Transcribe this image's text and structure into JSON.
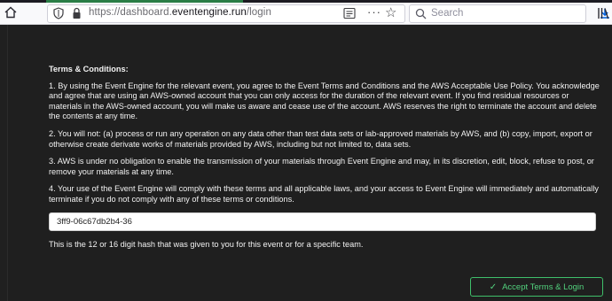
{
  "browser": {
    "url_prefix": "https://dashboard.",
    "url_domain": "eventengine.run",
    "url_path": "/login",
    "search_placeholder": "Search",
    "more_label": "···",
    "star_label": "☆"
  },
  "terms": {
    "title": "Terms & Conditions:",
    "paragraphs": [
      "1. By using the Event Engine for the relevant event, you agree to the Event Terms and Conditions and the AWS Acceptable Use Policy. You acknowledge and agree that are using an AWS-owned account that you can only access for the duration of the relevant event. If you find residual resources or materials in the AWS-owned account, you will make us aware and cease use of the account. AWS reserves the right to terminate the account and delete the contents at any time.",
      "2. You will not: (a) process or run any operation on any data other than test data sets or lab-approved materials by AWS, and (b) copy, import, export or otherwise create derivate works of materials provided by AWS, including but not limited to, data sets.",
      "3. AWS is under no obligation to enable the transmission of your materials through Event Engine and may, in its discretion, edit, block, refuse to post, or remove your materials at any time.",
      "4. Your use of the Event Engine will comply with these terms and all applicable laws, and your access to Event Engine will immediately and automatically terminate if you do not comply with any of these terms or conditions."
    ]
  },
  "hash_input": {
    "value": "3ff9-06c67db2b4-36"
  },
  "hint": "This is the 12 or 16 digit hash that was given to you for this event or for a specific team.",
  "accept_button": {
    "label": "Accept Terms & Login",
    "icon": "✓"
  },
  "colors": {
    "page_bg": "#1f1f1f",
    "accent_green": "#52d17d"
  }
}
